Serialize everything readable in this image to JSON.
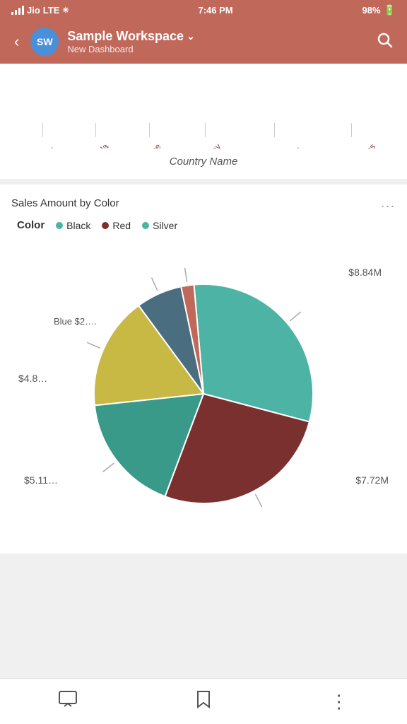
{
  "statusBar": {
    "carrier": "Jio",
    "network": "LTE",
    "time": "7:46 PM",
    "battery": "98%"
  },
  "header": {
    "back_label": "‹",
    "avatar_text": "SW",
    "workspace_name": "Sample Workspace",
    "chevron": "⌄",
    "subtitle": "New Dashboard",
    "search_icon": "🔍"
  },
  "barChart": {
    "x_axis_label": "Country Name",
    "countries": [
      "Aust…",
      "Canada",
      "France",
      "Germany",
      "United King…",
      "United States"
    ]
  },
  "pieChart": {
    "title": "Sales Amount by Color",
    "more_label": "...",
    "legend": {
      "title": "Color",
      "items": [
        {
          "label": "Black",
          "color": "#4db3a4"
        },
        {
          "label": "Red",
          "color": "#8B3A3A"
        },
        {
          "label": "Silver",
          "color": "#4db3a4"
        }
      ]
    },
    "segments": [
      {
        "label": "$8.84M",
        "color": "#4db3a4",
        "value": 8.84
      },
      {
        "label": "$7.72M",
        "color": "#7B3030",
        "value": 7.72
      },
      {
        "label": "$5.11…",
        "color": "#3a9a8a",
        "value": 5.11
      },
      {
        "label": "$4.8…",
        "color": "#d4c84a",
        "value": 4.8
      },
      {
        "label": "Blue $2….",
        "color": "#4a6d80",
        "value": 2.5
      },
      {
        "label": "",
        "color": "#c0685a",
        "value": 0.5
      }
    ]
  },
  "bottomNav": {
    "comment_icon": "💬",
    "star_icon": "☆",
    "more_icon": "⋮"
  }
}
